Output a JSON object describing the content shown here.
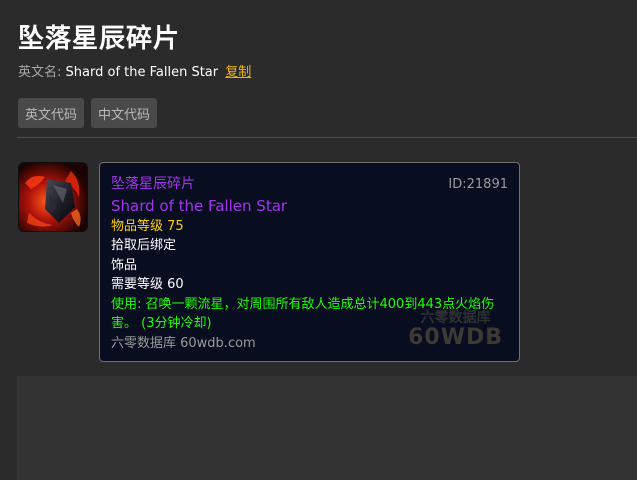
{
  "page": {
    "title": "坠落星辰碎片",
    "english_label": "英文名:",
    "english_name": "Shard of the Fallen Star",
    "copy_link": "复制"
  },
  "buttons": {
    "en_code": "英文代码",
    "cn_code": "中文代码"
  },
  "item_icon": {
    "name": "shard-icon"
  },
  "tooltip": {
    "name_cn": "坠落星辰碎片",
    "item_id": "ID:21891",
    "name_en": "Shard of the Fallen Star",
    "item_level": "物品等级 75",
    "binding": "拾取后绑定",
    "slot": "饰品",
    "required_level": "需要等级 60",
    "use_effect": "使用: 召唤一颗流星，对周围所有敌人造成总计400到443点火焰伤害。 (3分钟冷却)",
    "source": "六零数据库 60wdb.com",
    "watermark_line1": "六零数据库",
    "watermark_line2": "60WDB"
  },
  "colors": {
    "background": "#2b2b2b",
    "epic_purple": "#a335ee",
    "item_level_yellow": "#ffd100",
    "use_green": "#1eff00",
    "copy_link": "#f0b400",
    "tooltip_bg": "#080d20"
  }
}
